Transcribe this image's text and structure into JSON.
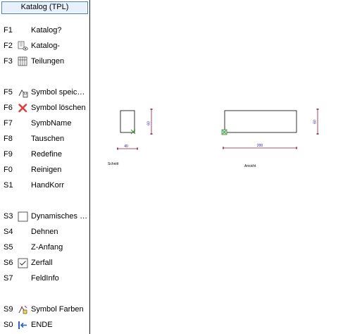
{
  "panel": {
    "title": "Katalog (TPL)",
    "items": [
      {
        "key": "F1",
        "label": "Katalog?",
        "icon": "none"
      },
      {
        "key": "F2",
        "label": "Katalog-",
        "icon": "catalog-remove-icon"
      },
      {
        "key": "F3",
        "label": "Teilungen",
        "icon": "grid-icon"
      },
      {
        "key": "F5",
        "label": "Symbol speichern",
        "icon": "symbol-save-icon"
      },
      {
        "key": "F6",
        "label": "Symbol löschen",
        "icon": "red-x-icon"
      },
      {
        "key": "F7",
        "label": "SymbName",
        "icon": "none"
      },
      {
        "key": "F8",
        "label": "Tauschen",
        "icon": "none"
      },
      {
        "key": "F9",
        "label": "Redefine",
        "icon": "none"
      },
      {
        "key": "F0",
        "label": "Reinigen",
        "icon": "none"
      },
      {
        "key": "S1",
        "label": "HandKorr",
        "icon": "none"
      },
      {
        "key": "S3",
        "label": "Dynamisches Symbol",
        "icon": "checkbox-empty-icon"
      },
      {
        "key": "S4",
        "label": "Dehnen",
        "icon": "none"
      },
      {
        "key": "S5",
        "label": "Z-Anfang",
        "icon": "none"
      },
      {
        "key": "S6",
        "label": "Zerfall",
        "icon": "checkbox-checked-icon"
      },
      {
        "key": "S7",
        "label": "FeldInfo",
        "icon": "none"
      },
      {
        "key": "S9",
        "label": "Symbol Farben",
        "icon": "symbol-color-icon"
      },
      {
        "key": "S0",
        "label": "ENDE",
        "icon": "exit-arrow-icon"
      }
    ]
  },
  "drawing": {
    "left_view": {
      "caption": "Schnitt",
      "width_dim": "40",
      "height_dim": "60"
    },
    "right_view": {
      "caption": "Ansicht",
      "width_dim": "200",
      "height_dim": "60"
    },
    "colors": {
      "dimension": "#8b1a3a",
      "dimension_text": "#1a1a8a",
      "outline": "#000000",
      "marker": "#2e8b2e"
    }
  }
}
